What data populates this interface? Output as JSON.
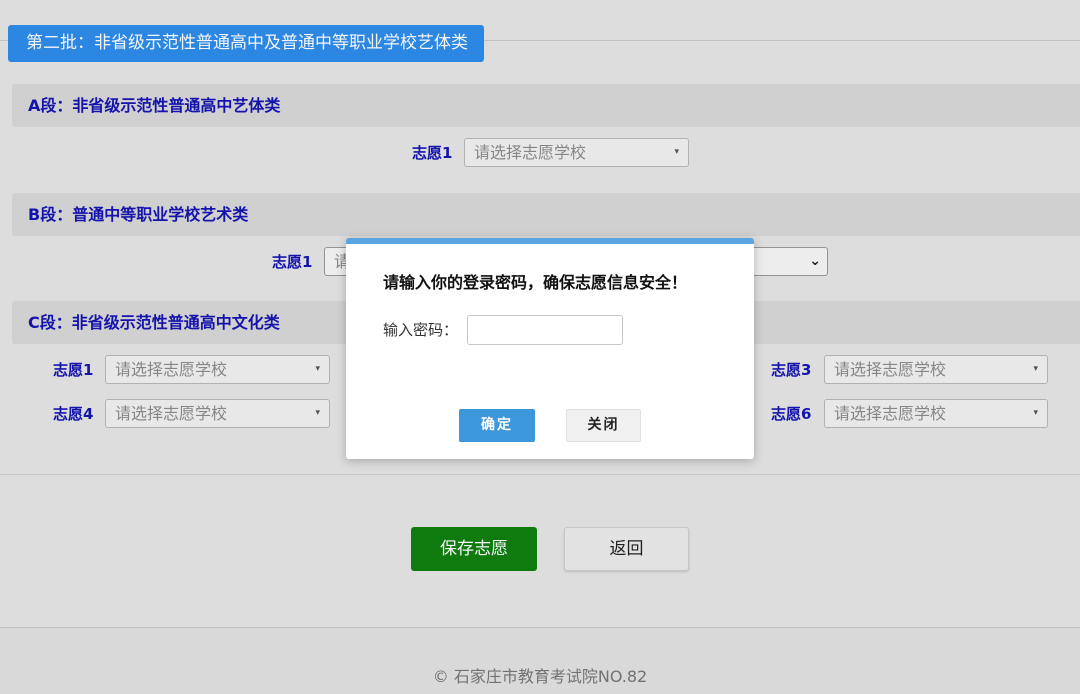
{
  "batch_tab": "第二批：非省级示范性普通高中及普通中等职业学校艺体类",
  "sections": {
    "a": {
      "title": "A段：非省级示范性普通高中艺体类",
      "choices": [
        {
          "label": "志愿1",
          "placeholder": "请选择志愿学校"
        }
      ]
    },
    "b": {
      "title": "B段：普通中等职业学校艺术类",
      "choices": [
        {
          "label": "志愿1",
          "placeholder": "请"
        }
      ]
    },
    "c": {
      "title": "C段：非省级示范性普通高中文化类",
      "choices": [
        {
          "label": "志愿1",
          "placeholder": "请选择志愿学校"
        },
        {
          "label": "志愿3",
          "placeholder": "请选择志愿学校"
        },
        {
          "label": "志愿4",
          "placeholder": "请选择志愿学校"
        },
        {
          "label": "志愿6",
          "placeholder": "请选择志愿学校"
        }
      ]
    }
  },
  "buttons": {
    "save": "保存志愿",
    "back": "返回"
  },
  "footer": "© 石家庄市教育考试院NO.82",
  "dialog": {
    "message": "请输入你的登录密码，确保志愿信息安全！",
    "password_label": "输入密码：",
    "password_value": "",
    "ok": "确定",
    "close": "关闭"
  },
  "icons": {
    "caret": "▾",
    "chevron": "⌄"
  },
  "colors": {
    "tab_blue": "#2e8ded",
    "section_label": "#1515b5",
    "save_green": "#108010",
    "dialog_accent": "#5aa5e0",
    "ok_blue": "#3d97db"
  }
}
